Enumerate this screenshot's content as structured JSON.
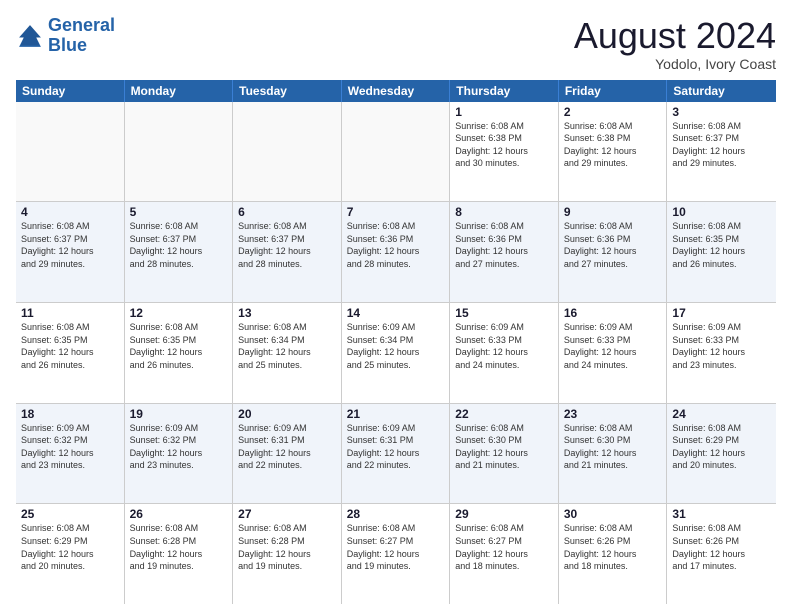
{
  "logo": {
    "line1": "General",
    "line2": "Blue"
  },
  "title": "August 2024",
  "subtitle": "Yodolo, Ivory Coast",
  "calendar": {
    "weekdays": [
      "Sunday",
      "Monday",
      "Tuesday",
      "Wednesday",
      "Thursday",
      "Friday",
      "Saturday"
    ],
    "rows": [
      [
        {
          "day": "",
          "info": ""
        },
        {
          "day": "",
          "info": ""
        },
        {
          "day": "",
          "info": ""
        },
        {
          "day": "",
          "info": ""
        },
        {
          "day": "1",
          "info": "Sunrise: 6:08 AM\nSunset: 6:38 PM\nDaylight: 12 hours\nand 30 minutes."
        },
        {
          "day": "2",
          "info": "Sunrise: 6:08 AM\nSunset: 6:38 PM\nDaylight: 12 hours\nand 29 minutes."
        },
        {
          "day": "3",
          "info": "Sunrise: 6:08 AM\nSunset: 6:37 PM\nDaylight: 12 hours\nand 29 minutes."
        }
      ],
      [
        {
          "day": "4",
          "info": "Sunrise: 6:08 AM\nSunset: 6:37 PM\nDaylight: 12 hours\nand 29 minutes."
        },
        {
          "day": "5",
          "info": "Sunrise: 6:08 AM\nSunset: 6:37 PM\nDaylight: 12 hours\nand 28 minutes."
        },
        {
          "day": "6",
          "info": "Sunrise: 6:08 AM\nSunset: 6:37 PM\nDaylight: 12 hours\nand 28 minutes."
        },
        {
          "day": "7",
          "info": "Sunrise: 6:08 AM\nSunset: 6:36 PM\nDaylight: 12 hours\nand 28 minutes."
        },
        {
          "day": "8",
          "info": "Sunrise: 6:08 AM\nSunset: 6:36 PM\nDaylight: 12 hours\nand 27 minutes."
        },
        {
          "day": "9",
          "info": "Sunrise: 6:08 AM\nSunset: 6:36 PM\nDaylight: 12 hours\nand 27 minutes."
        },
        {
          "day": "10",
          "info": "Sunrise: 6:08 AM\nSunset: 6:35 PM\nDaylight: 12 hours\nand 26 minutes."
        }
      ],
      [
        {
          "day": "11",
          "info": "Sunrise: 6:08 AM\nSunset: 6:35 PM\nDaylight: 12 hours\nand 26 minutes."
        },
        {
          "day": "12",
          "info": "Sunrise: 6:08 AM\nSunset: 6:35 PM\nDaylight: 12 hours\nand 26 minutes."
        },
        {
          "day": "13",
          "info": "Sunrise: 6:08 AM\nSunset: 6:34 PM\nDaylight: 12 hours\nand 25 minutes."
        },
        {
          "day": "14",
          "info": "Sunrise: 6:09 AM\nSunset: 6:34 PM\nDaylight: 12 hours\nand 25 minutes."
        },
        {
          "day": "15",
          "info": "Sunrise: 6:09 AM\nSunset: 6:33 PM\nDaylight: 12 hours\nand 24 minutes."
        },
        {
          "day": "16",
          "info": "Sunrise: 6:09 AM\nSunset: 6:33 PM\nDaylight: 12 hours\nand 24 minutes."
        },
        {
          "day": "17",
          "info": "Sunrise: 6:09 AM\nSunset: 6:33 PM\nDaylight: 12 hours\nand 23 minutes."
        }
      ],
      [
        {
          "day": "18",
          "info": "Sunrise: 6:09 AM\nSunset: 6:32 PM\nDaylight: 12 hours\nand 23 minutes."
        },
        {
          "day": "19",
          "info": "Sunrise: 6:09 AM\nSunset: 6:32 PM\nDaylight: 12 hours\nand 23 minutes."
        },
        {
          "day": "20",
          "info": "Sunrise: 6:09 AM\nSunset: 6:31 PM\nDaylight: 12 hours\nand 22 minutes."
        },
        {
          "day": "21",
          "info": "Sunrise: 6:09 AM\nSunset: 6:31 PM\nDaylight: 12 hours\nand 22 minutes."
        },
        {
          "day": "22",
          "info": "Sunrise: 6:08 AM\nSunset: 6:30 PM\nDaylight: 12 hours\nand 21 minutes."
        },
        {
          "day": "23",
          "info": "Sunrise: 6:08 AM\nSunset: 6:30 PM\nDaylight: 12 hours\nand 21 minutes."
        },
        {
          "day": "24",
          "info": "Sunrise: 6:08 AM\nSunset: 6:29 PM\nDaylight: 12 hours\nand 20 minutes."
        }
      ],
      [
        {
          "day": "25",
          "info": "Sunrise: 6:08 AM\nSunset: 6:29 PM\nDaylight: 12 hours\nand 20 minutes."
        },
        {
          "day": "26",
          "info": "Sunrise: 6:08 AM\nSunset: 6:28 PM\nDaylight: 12 hours\nand 19 minutes."
        },
        {
          "day": "27",
          "info": "Sunrise: 6:08 AM\nSunset: 6:28 PM\nDaylight: 12 hours\nand 19 minutes."
        },
        {
          "day": "28",
          "info": "Sunrise: 6:08 AM\nSunset: 6:27 PM\nDaylight: 12 hours\nand 19 minutes."
        },
        {
          "day": "29",
          "info": "Sunrise: 6:08 AM\nSunset: 6:27 PM\nDaylight: 12 hours\nand 18 minutes."
        },
        {
          "day": "30",
          "info": "Sunrise: 6:08 AM\nSunset: 6:26 PM\nDaylight: 12 hours\nand 18 minutes."
        },
        {
          "day": "31",
          "info": "Sunrise: 6:08 AM\nSunset: 6:26 PM\nDaylight: 12 hours\nand 17 minutes."
        }
      ]
    ]
  }
}
